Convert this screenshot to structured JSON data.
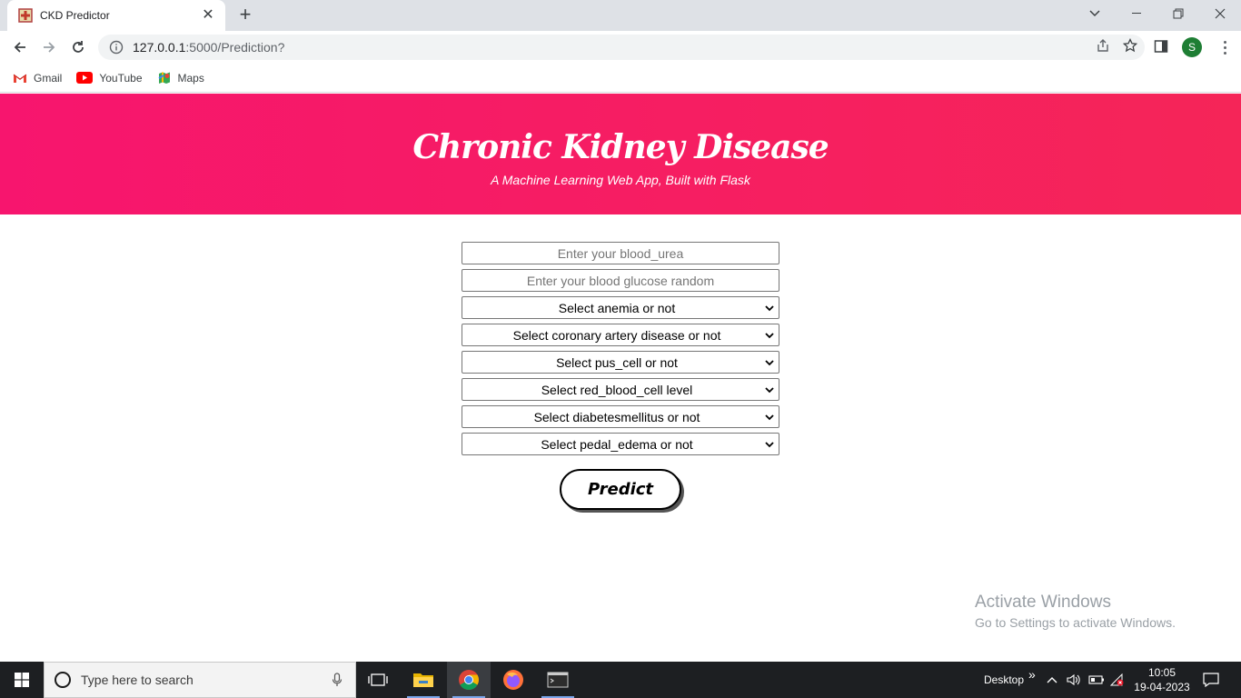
{
  "browser": {
    "tab_title": "CKD Predictor",
    "new_tab": "+",
    "url_host": "127.0.0.1",
    "url_rest": ":5000/Prediction?",
    "profile_initial": "S",
    "bookmarks": [
      {
        "label": "Gmail",
        "icon": "gmail-icon"
      },
      {
        "label": "YouTube",
        "icon": "youtube-icon"
      },
      {
        "label": "Maps",
        "icon": "maps-icon"
      }
    ]
  },
  "page": {
    "title": "Chronic Kidney Disease",
    "subtitle": "A Machine Learning Web App, Built with Flask",
    "accent": "#f52558",
    "inputs": [
      {
        "placeholder": "Enter your blood_urea",
        "value": ""
      },
      {
        "placeholder": "Enter your blood glucose random",
        "value": ""
      }
    ],
    "selects": [
      "Select anemia or not",
      "Select coronary artery disease or not",
      "Select pus_cell or not",
      "Select red_blood_cell level",
      "Select diabetesmellitus or not",
      "Select pedal_edema or not"
    ],
    "predict_label": "Predict"
  },
  "watermark": {
    "line1": "Activate Windows",
    "line2": "Go to Settings to activate Windows."
  },
  "taskbar": {
    "search_placeholder": "Type here to search",
    "desktop_label": "Desktop",
    "chevron": "»",
    "time": "10:05",
    "date": "19-04-2023"
  }
}
